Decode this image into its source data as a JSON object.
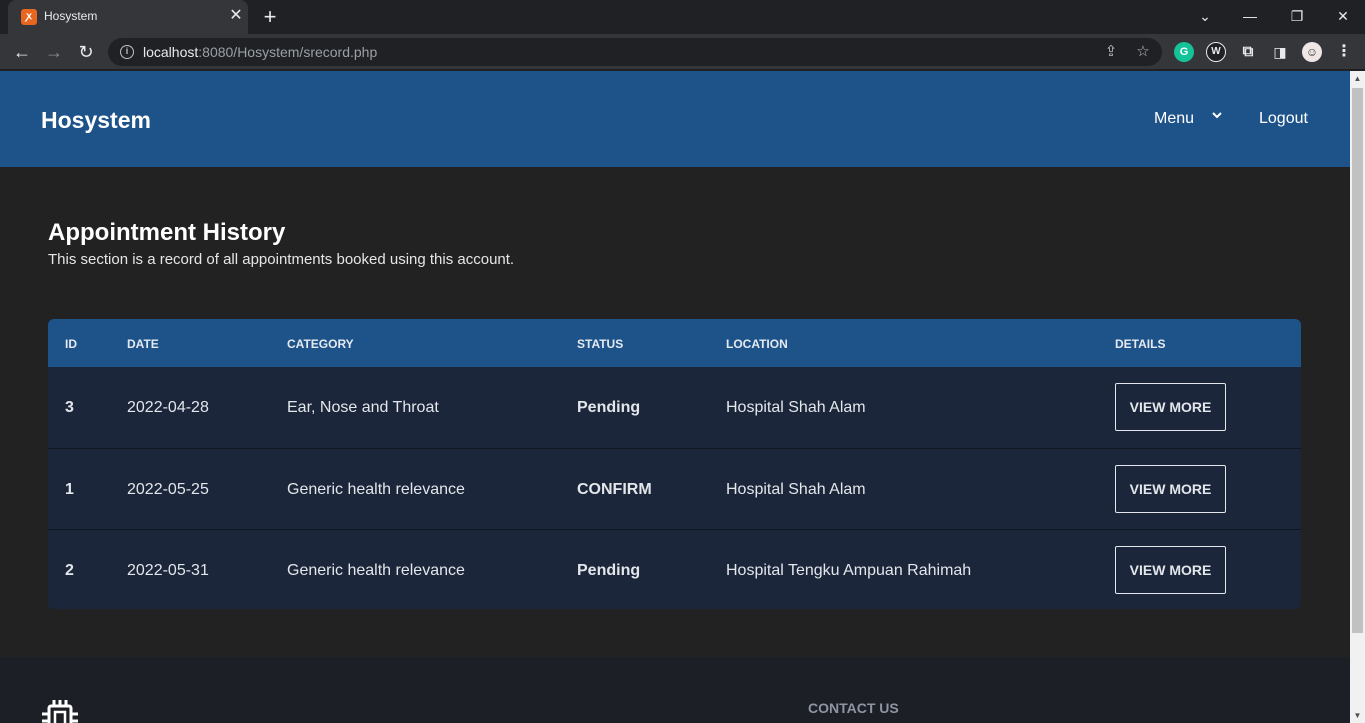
{
  "browser": {
    "tab_title": "Hosystem",
    "url_host": "localhost",
    "url_rest": ":8080/Hosystem/srecord.php"
  },
  "header": {
    "brand": "Hosystem",
    "menu_label": "Menu",
    "logout_label": "Logout"
  },
  "main": {
    "title": "Appointment History",
    "subtitle": "This section is a record of all appointments booked using this account."
  },
  "table": {
    "headers": [
      "ID",
      "DATE",
      "CATEGORY",
      "STATUS",
      "LOCATION",
      "DETAILS"
    ],
    "rows": [
      {
        "id": "3",
        "date": "2022-04-28",
        "category": "Ear, Nose and Throat",
        "status": "Pending",
        "location": "Hospital Shah Alam",
        "action": "VIEW MORE"
      },
      {
        "id": "1",
        "date": "2022-05-25",
        "category": "Generic health relevance",
        "status": "CONFIRM",
        "location": "Hospital Shah Alam",
        "action": "VIEW MORE"
      },
      {
        "id": "2",
        "date": "2022-05-31",
        "category": "Generic health relevance",
        "status": "Pending",
        "location": "Hospital Tengku Ampuan Rahimah",
        "action": "VIEW MORE"
      }
    ]
  },
  "footer": {
    "contact_heading": "CONTACT US"
  },
  "colors": {
    "header_bg": "#1e538a",
    "page_bg": "#222222",
    "table_body_bg": "#1b263a",
    "footer_bg": "#1c1f26"
  }
}
